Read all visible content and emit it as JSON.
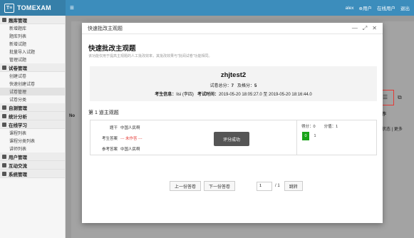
{
  "app": {
    "logo_mark": "T≡",
    "name": "TOMEXAM"
  },
  "topbar": {
    "user": "alex",
    "links": [
      "⊕用户",
      "在线用户",
      "退出"
    ]
  },
  "sidebar": {
    "groups": [
      {
        "label": "题库管理",
        "items": [
          "新增题库",
          "题库列表",
          "新增试题",
          "批量导入试题",
          "管理试题"
        ]
      },
      {
        "label": "试卷管理",
        "items": [
          "创建试卷",
          "快速创建试卷",
          "试卷管理",
          "试卷分类"
        ]
      },
      {
        "label": "自测管理",
        "items": []
      },
      {
        "label": "统计分析",
        "items": []
      },
      {
        "label": "在线学习",
        "items": [
          "课程列表",
          "课程分类列表",
          "讲师列表"
        ]
      },
      {
        "label": "用户管理",
        "items": []
      },
      {
        "label": "互动交流",
        "items": []
      },
      {
        "label": "系统管理",
        "items": []
      }
    ],
    "active_item": "试卷管理"
  },
  "background": {
    "op_header": "操作",
    "op_links": "状态 | 更多",
    "tab_label": "No"
  },
  "modal": {
    "header_title": "快速批改主观题",
    "title": "快速批改主观题",
    "subtitle": "该功能仅用于提高主观题的人工批改效率，其批改效果与\"批阅试卷\"功能相同。",
    "user": "zhjtest2",
    "score_label": "试卷总分：",
    "score_total": "7",
    "pass_label": "及格分：",
    "pass_score": "5",
    "info_candidate_label": "考生信息：",
    "info_candidate": "lisi (李四)",
    "info_time_label": "考试时间：",
    "info_time": "2019-05-20 18:05:27.0 至 2019-05-20 18:16:44.0",
    "question_title": "第 1 道主观题",
    "stem_label": "题干",
    "stem": "中国人民啊",
    "answer_label": "考生答案",
    "answer": "--- 未作答 ---",
    "ref_label": "参考答案",
    "ref": "中国人民啊",
    "score_got_label": "得分：0",
    "score_max_label": "分值：1",
    "score_options": [
      "0",
      "1"
    ],
    "toast": "评分成功",
    "prev_button": "上一份答卷",
    "next_button": "下一份答卷",
    "page_value": "1",
    "page_total": "/ 1",
    "jump_button": "跳转"
  }
}
